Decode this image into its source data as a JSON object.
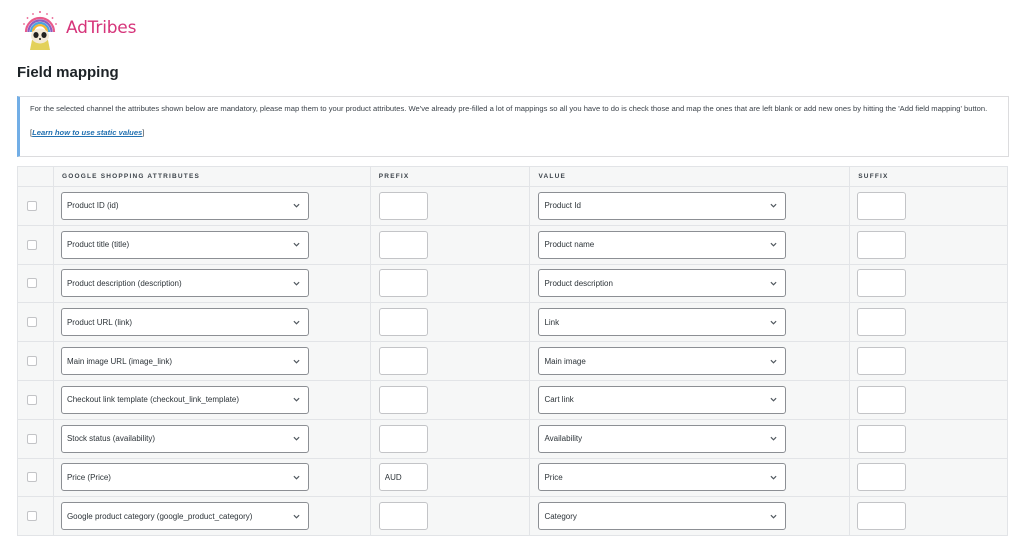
{
  "brand": {
    "name": "AdTribes",
    "logo_icon": "panda-headdress-logo"
  },
  "page": {
    "title": "Field mapping"
  },
  "notice": {
    "text": "For the selected channel the attributes shown below are mandatory, please map them to your product attributes. We've already pre-filled a lot of mappings so all you have to do is check those and map the ones that are left blank or add new ones by hitting the 'Add field mapping' button.",
    "link_open": "[",
    "link_label": "Learn how to use static values",
    "link_close": "]",
    "accent_color": "#72aee6"
  },
  "table": {
    "headers": {
      "attribute": "GOOGLE SHOPPING ATTRIBUTES",
      "prefix": "PREFIX",
      "value": "VALUE",
      "suffix": "SUFFIX"
    },
    "rows": [
      {
        "checked": false,
        "attribute": "Product ID (id)",
        "prefix": "",
        "value": "Product Id",
        "suffix": ""
      },
      {
        "checked": false,
        "attribute": "Product title (title)",
        "prefix": "",
        "value": "Product name",
        "suffix": ""
      },
      {
        "checked": false,
        "attribute": "Product description (description)",
        "prefix": "",
        "value": "Product description",
        "suffix": ""
      },
      {
        "checked": false,
        "attribute": "Product URL (link)",
        "prefix": "",
        "value": "Link",
        "suffix": ""
      },
      {
        "checked": false,
        "attribute": "Main image URL (image_link)",
        "prefix": "",
        "value": "Main image",
        "suffix": ""
      },
      {
        "checked": false,
        "attribute": "Checkout link template (checkout_link_template)",
        "prefix": "",
        "value": "Cart link",
        "suffix": ""
      },
      {
        "checked": false,
        "attribute": "Stock status (availability)",
        "prefix": "",
        "value": "Availability",
        "suffix": ""
      },
      {
        "checked": false,
        "attribute": "Price (Price)",
        "prefix": "AUD",
        "value": "Price",
        "suffix": ""
      },
      {
        "checked": false,
        "attribute": "Google product category (google_product_category)",
        "prefix": "",
        "value": "Category",
        "suffix": ""
      }
    ]
  }
}
